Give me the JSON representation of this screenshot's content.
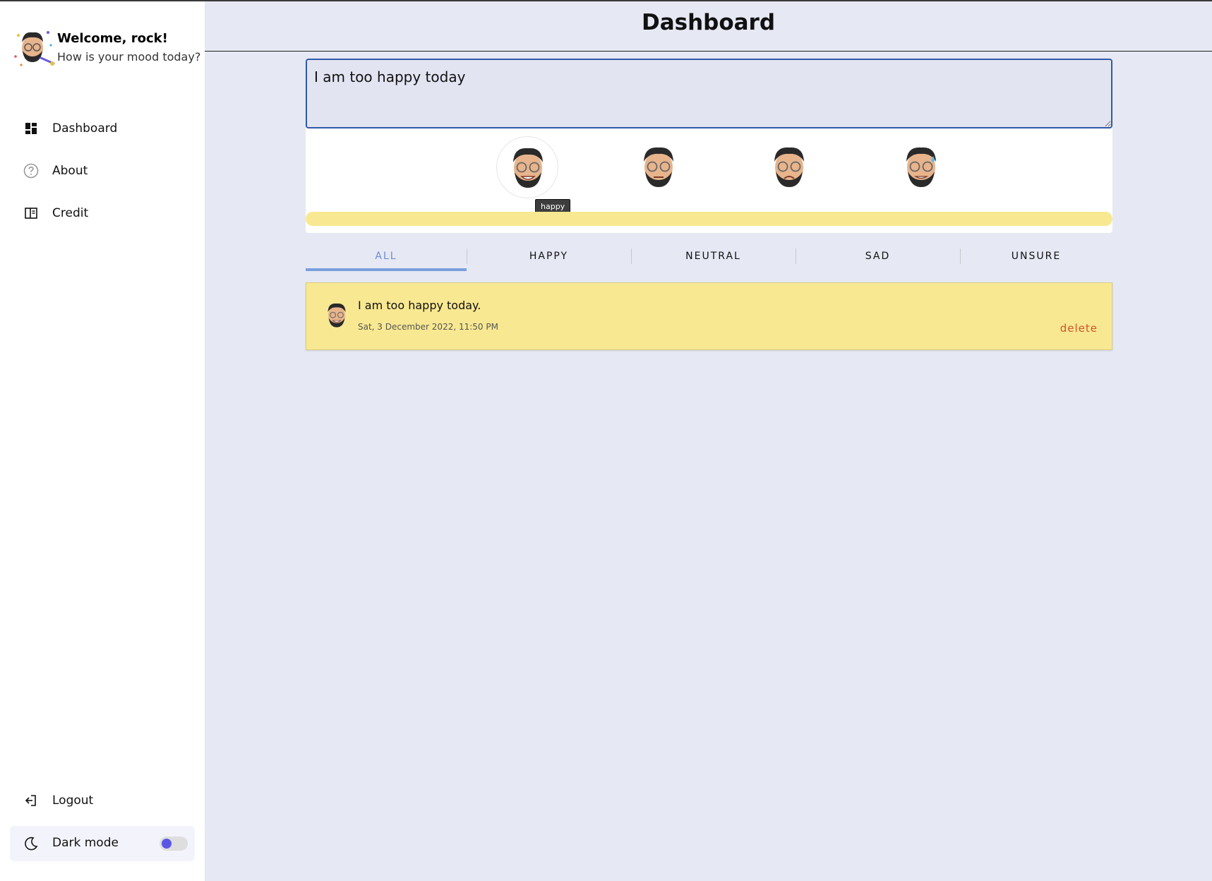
{
  "sidebar": {
    "welcome": "Welcome, rock!",
    "mood_question": "How is your mood today?",
    "nav": [
      {
        "label": "Dashboard",
        "icon": "dashboard-icon"
      },
      {
        "label": "About",
        "icon": "help-circle-icon"
      },
      {
        "label": "Credit",
        "icon": "book-icon"
      }
    ],
    "logout_label": "Logout",
    "dark_mode_label": "Dark mode",
    "dark_mode_on": false
  },
  "page": {
    "title": "Dashboard"
  },
  "entry": {
    "value": "I am too happy today",
    "moods": [
      "happy",
      "neutral",
      "sad",
      "unsure"
    ],
    "selected_mood": "happy",
    "tooltip": "happy",
    "bar_color": "#f8e891"
  },
  "tabs": [
    {
      "label": "ALL",
      "active": true
    },
    {
      "label": "HAPPY",
      "active": false
    },
    {
      "label": "NEUTRAL",
      "active": false
    },
    {
      "label": "SAD",
      "active": false
    },
    {
      "label": "UNSURE",
      "active": false
    }
  ],
  "moods_list": [
    {
      "text": "I am too happy today.",
      "time": "Sat, 3 December 2022, 11:50 PM",
      "delete_label": "delete",
      "mood": "happy"
    }
  ],
  "colors": {
    "accent": "#7aa0dc",
    "happy": "#f8e891",
    "delete": "#d0532a",
    "toggle_knob": "#5b55e6"
  }
}
